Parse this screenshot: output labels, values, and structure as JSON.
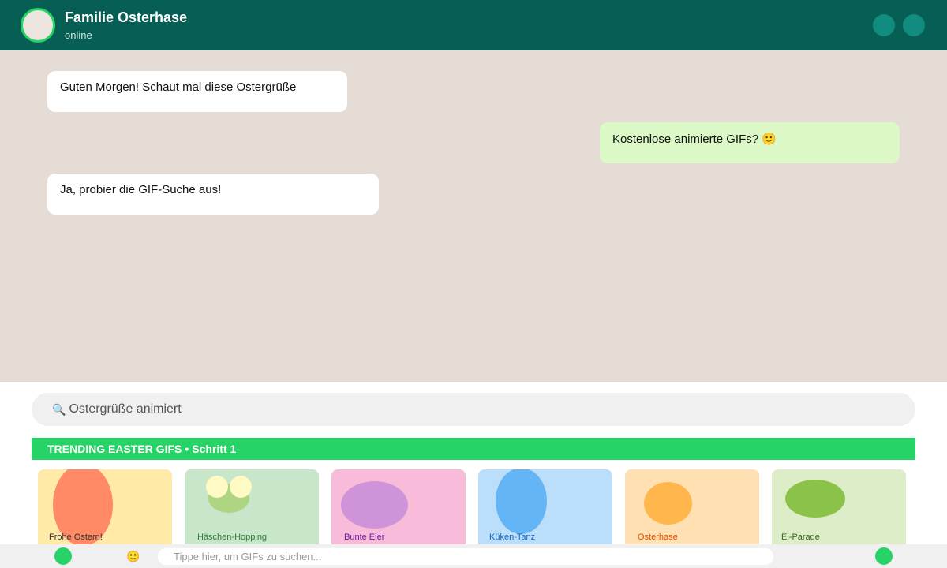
{
  "header": {
    "title": "Familie Osterhase",
    "status": "online",
    "icons": [
      "avatar",
      "header-button",
      "header-button"
    ]
  },
  "messages": [
    {
      "direction": "incoming",
      "text": "Guten Morgen! Schaut mal diese Ostergrüße"
    },
    {
      "direction": "outgoing",
      "text": "Kostenlose animierte GIFs? 🙂"
    },
    {
      "direction": "incoming",
      "text": "Ja, probier die GIF-Suche aus!"
    }
  ],
  "gif_panel": {
    "search_query": "Ostergrüße animiert",
    "search_icon": "search-icon",
    "section_title": "TRENDING EASTER GIFS",
    "separator": "•",
    "step_label": "Schritt 1",
    "tiles": [
      {
        "caption": "Frohe Ostern!",
        "bg": "#ffeaa7",
        "accent": "#ff8a65",
        "caption_color": "#333333"
      },
      {
        "caption": "Häschen-Hopping",
        "bg": "#c8e6c9",
        "accent": "#aed581",
        "caption_color": "#2e7d32"
      },
      {
        "caption": "Bunte Eier",
        "bg": "#f8bbd9",
        "accent": "#ce93d8",
        "caption_color": "#6a1b9a"
      },
      {
        "caption": "Küken-Tanz",
        "bg": "#bbdefb",
        "accent": "#64b5f6",
        "caption_color": "#1565c0"
      },
      {
        "caption": "Osterhase",
        "bg": "#ffe0b2",
        "accent": "#ffb74d",
        "caption_color": "#e65100"
      },
      {
        "caption": "Ei-Parade",
        "bg": "#dcedc8",
        "accent": "#8bc34a",
        "caption_color": "#33691e"
      }
    ]
  },
  "input_bar": {
    "placeholder": "Tippe hier, um GIFs zu suchen...",
    "emoji": "🙂"
  },
  "colors": {
    "header": "#075e54",
    "accent": "#25d366",
    "chat_bg": "#e5ddd5",
    "incoming_bubble": "#ffffff",
    "outgoing_bubble": "#dcf8c6"
  }
}
